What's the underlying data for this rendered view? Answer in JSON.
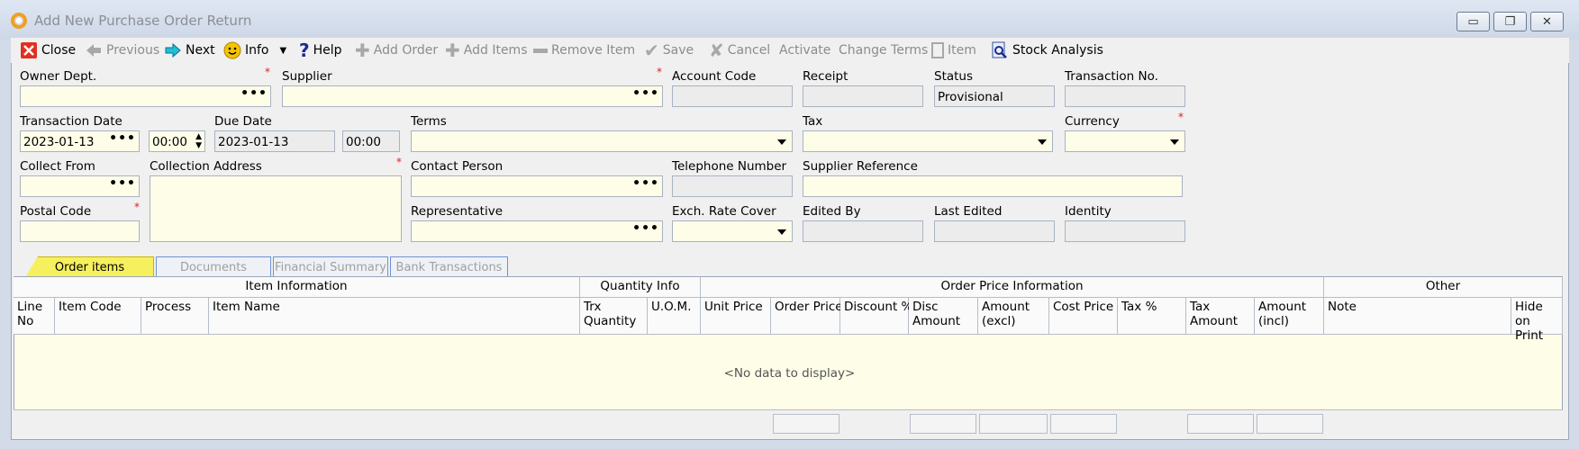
{
  "window": {
    "title": "Add New Purchase Order Return"
  },
  "toolbar": {
    "close": "Close",
    "previous": "Previous",
    "next": "Next",
    "info": "Info",
    "help": "Help",
    "add_order": "Add Order",
    "add_items": "Add Items",
    "remove_item": "Remove Item",
    "save": "Save",
    "cancel": "Cancel",
    "activate": "Activate",
    "change_terms": "Change Terms",
    "item": "Item",
    "stock_analysis": "Stock Analysis"
  },
  "form": {
    "owner_dept": {
      "label": "Owner Dept.",
      "value": ""
    },
    "supplier": {
      "label": "Supplier",
      "value": ""
    },
    "account_code": {
      "label": "Account Code",
      "value": ""
    },
    "receipt": {
      "label": "Receipt",
      "value": ""
    },
    "status": {
      "label": "Status",
      "value": "Provisional"
    },
    "transaction_no": {
      "label": "Transaction No.",
      "value": ""
    },
    "transaction_date": {
      "label": "Transaction Date",
      "value": "2023-01-13",
      "time": "00:00"
    },
    "due_date": {
      "label": "Due Date",
      "value": "2023-01-13",
      "time": "00:00"
    },
    "terms": {
      "label": "Terms",
      "value": ""
    },
    "tax": {
      "label": "Tax",
      "value": ""
    },
    "currency": {
      "label": "Currency",
      "value": ""
    },
    "collect_from": {
      "label": "Collect From",
      "value": ""
    },
    "collection_address": {
      "label": "Collection Address",
      "value": ""
    },
    "contact_person": {
      "label": "Contact Person",
      "value": ""
    },
    "telephone_number": {
      "label": "Telephone Number",
      "value": ""
    },
    "supplier_reference": {
      "label": "Supplier Reference",
      "value": ""
    },
    "postal_code": {
      "label": "Postal Code",
      "value": ""
    },
    "representative": {
      "label": "Representative",
      "value": ""
    },
    "exch_rate_cover": {
      "label": "Exch. Rate Cover",
      "value": ""
    },
    "edited_by": {
      "label": "Edited By",
      "value": ""
    },
    "last_edited": {
      "label": "Last Edited",
      "value": ""
    },
    "identity": {
      "label": "Identity",
      "value": ""
    }
  },
  "tabs": [
    "Order items",
    "Documents",
    "Financial Summary",
    "Bank Transactions"
  ],
  "grid": {
    "groups": [
      "Item Information",
      "Quantity Info",
      "Order Price Information",
      "Other"
    ],
    "columns": [
      "Line No",
      "Item Code",
      "Process",
      "Item Name",
      "Trx Quantity",
      "U.O.M.",
      "Unit Price",
      "Order Price",
      "Discount %",
      "Disc Amount",
      "Amount (excl)",
      "Cost Price",
      "Tax %",
      "Tax Amount",
      "Amount (incl)",
      "Note",
      "Hide on Print"
    ],
    "empty_text": "<No data to display>"
  },
  "colors": {
    "input_bg": "#fdfde8",
    "active_tab": "#f7f05e",
    "required": "#e02020"
  }
}
